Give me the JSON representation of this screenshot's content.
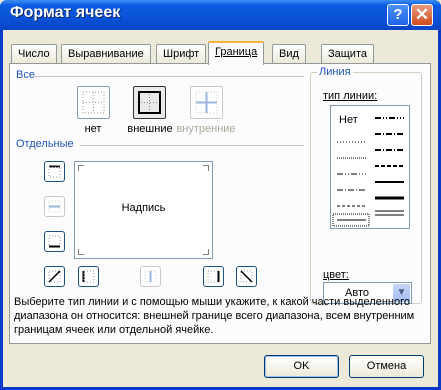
{
  "window": {
    "title": "Формат ячеек",
    "help_label": "?",
    "close_label": "✕"
  },
  "tabs": [
    {
      "label": "Число"
    },
    {
      "label": "Выравнивание"
    },
    {
      "label": "Шрифт"
    },
    {
      "label": "Граница"
    },
    {
      "label": "Вид"
    },
    {
      "label": "Защита"
    }
  ],
  "active_tab": "Граница",
  "presets": {
    "group_label": "Все",
    "none_label": "нет",
    "outline_label": "внешние",
    "inside_label": "внутренние"
  },
  "border": {
    "group_label": "Отдельные",
    "preview_text": "Надпись"
  },
  "line": {
    "group_label": "Линия",
    "style_label": "тип линии:",
    "none_label": "Нет",
    "color_label": "цвет:",
    "color_value": "Авто"
  },
  "description": "Выберите тип линии и с помощью мыши укажите, к какой части выделенного диапазона он относится: внешней границе всего диапазона, всем внутренним границам ячеек или отдельной ячейке.",
  "buttons": {
    "ok_label": "OK",
    "cancel_label": "Отмена"
  },
  "colors": {
    "accent": "#2154b8",
    "title_bar": "#0a5be0",
    "panel": "#fcfcfe"
  }
}
